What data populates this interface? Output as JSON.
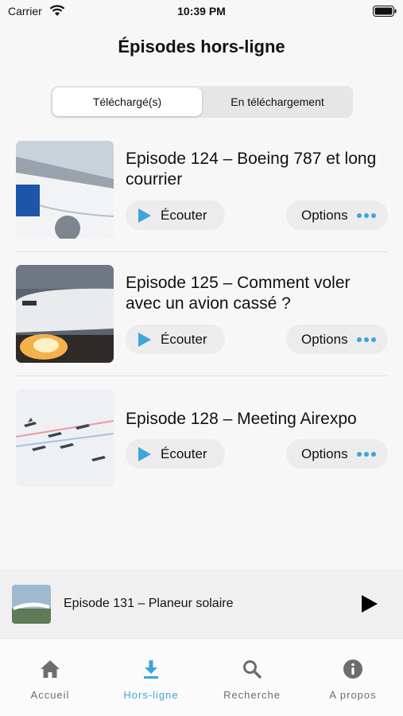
{
  "status_bar": {
    "carrier": "Carrier",
    "time": "10:39 PM"
  },
  "header": {
    "title": "Épisodes hors-ligne"
  },
  "segments": [
    {
      "label": "Téléchargé(s)",
      "selected": true
    },
    {
      "label": "En téléchargement",
      "selected": false
    }
  ],
  "episodes": [
    {
      "title": "Episode 124 – Boeing 787 et long courrier",
      "listen_label": "Écouter",
      "options_label": "Options",
      "thumbnail": "boeing-787-wing"
    },
    {
      "title": "Episode 125 – Comment voler avec un avion cassé ?",
      "listen_label": "Écouter",
      "options_label": "Options",
      "thumbnail": "airliner-engine-fire"
    },
    {
      "title": "Episode 128 – Meeting Airexpo",
      "listen_label": "Écouter",
      "options_label": "Options",
      "thumbnail": "patrouille-jets"
    }
  ],
  "mini_player": {
    "title": "Episode 131 – Planeur solaire",
    "icon": "play-icon"
  },
  "tabs": [
    {
      "label": "Accueil",
      "icon": "home-icon",
      "active": false
    },
    {
      "label": "Hors-ligne",
      "icon": "download-icon",
      "active": true
    },
    {
      "label": "Recherche",
      "icon": "search-icon",
      "active": false
    },
    {
      "label": "A propos",
      "icon": "info-icon",
      "active": false
    }
  ],
  "colors": {
    "accent": "#3da5d9",
    "inactive_tab": "#6d6d6d"
  }
}
